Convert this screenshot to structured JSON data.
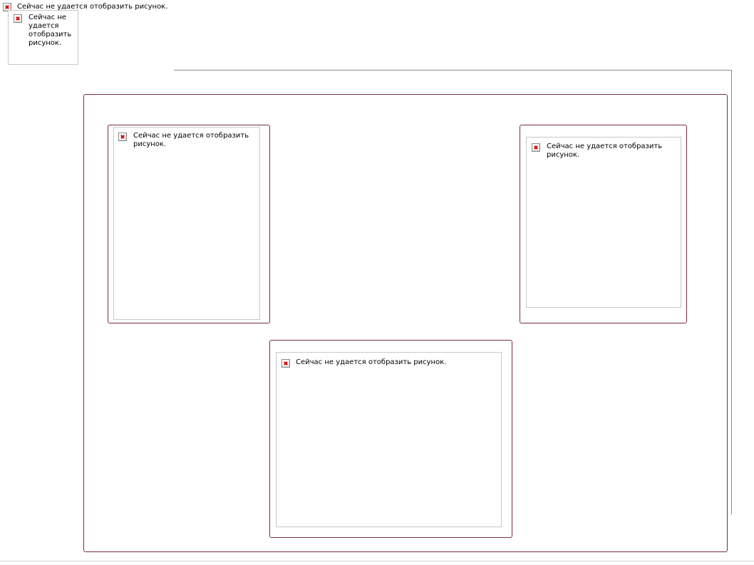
{
  "broken_image_alt": "Сейчас не удается отобразить рисунок.",
  "header": {
    "top_image_alt": "Сейчас не удается отобразить рисунок.",
    "logo_image_alt": "Сейчас не удается отобразить рисунок."
  },
  "panels": {
    "left_image_alt": "Сейчас не удается отобразить рисунок.",
    "right_image_alt": "Сейчас не удается отобразить рисунок.",
    "bottom_image_alt": "Сейчас не удается отобразить рисунок."
  },
  "colors": {
    "frame_border": "#7a2a4a",
    "image_border": "#c9c9c9",
    "rule": "#8c8c8c",
    "broken_icon_x": "#d40000"
  },
  "icons": {
    "broken_image": "broken-image-icon"
  }
}
